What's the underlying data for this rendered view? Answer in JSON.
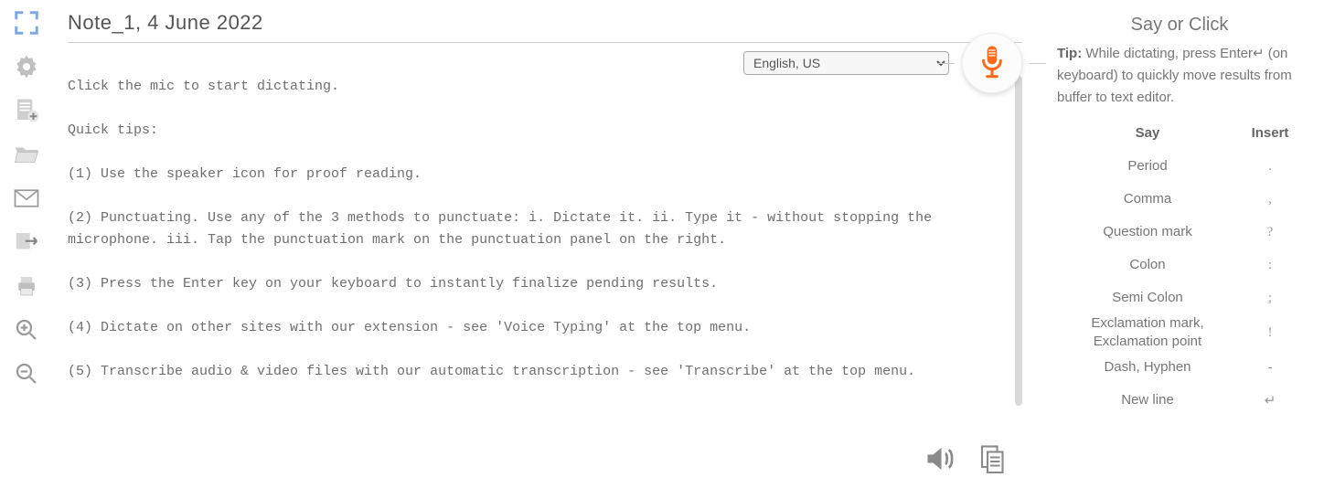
{
  "title": "Note_1, 4 June 2022",
  "language_selected": "English, US",
  "editor_text": "Click the mic to start dictating.\n\nQuick tips:\n\n(1) Use the speaker icon for proof reading.\n\n(2) Punctuating. Use any of the 3 methods to punctuate: i. Dictate it. ii. Type it - without stopping the microphone. iii. Tap the punctuation mark on the punctuation panel on the right.\n\n(3) Press the Enter key on your keyboard to instantly finalize pending results.\n\n(4) Dictate on other sites with our extension - see 'Voice Typing' at the top menu.\n\n(5) Transcribe audio & video files with our automatic transcription - see 'Transcribe' at the top menu.",
  "right": {
    "heading": "Say or Click",
    "tip_label": "Tip:",
    "tip_text": " While dictating, press Enter↵ (on keyboard) to quickly move results from buffer to text editor.",
    "columns": {
      "say": "Say",
      "insert": "Insert"
    },
    "rows": [
      {
        "say": "Period",
        "insert": "."
      },
      {
        "say": "Comma",
        "insert": ","
      },
      {
        "say": "Question mark",
        "insert": "?"
      },
      {
        "say": "Colon",
        "insert": ":"
      },
      {
        "say": "Semi Colon",
        "insert": ";"
      },
      {
        "say": "Exclamation mark, Exclamation point",
        "insert": "!"
      },
      {
        "say": "Dash, Hyphen",
        "insert": "-"
      },
      {
        "say": "New line",
        "insert": "↵"
      }
    ]
  }
}
